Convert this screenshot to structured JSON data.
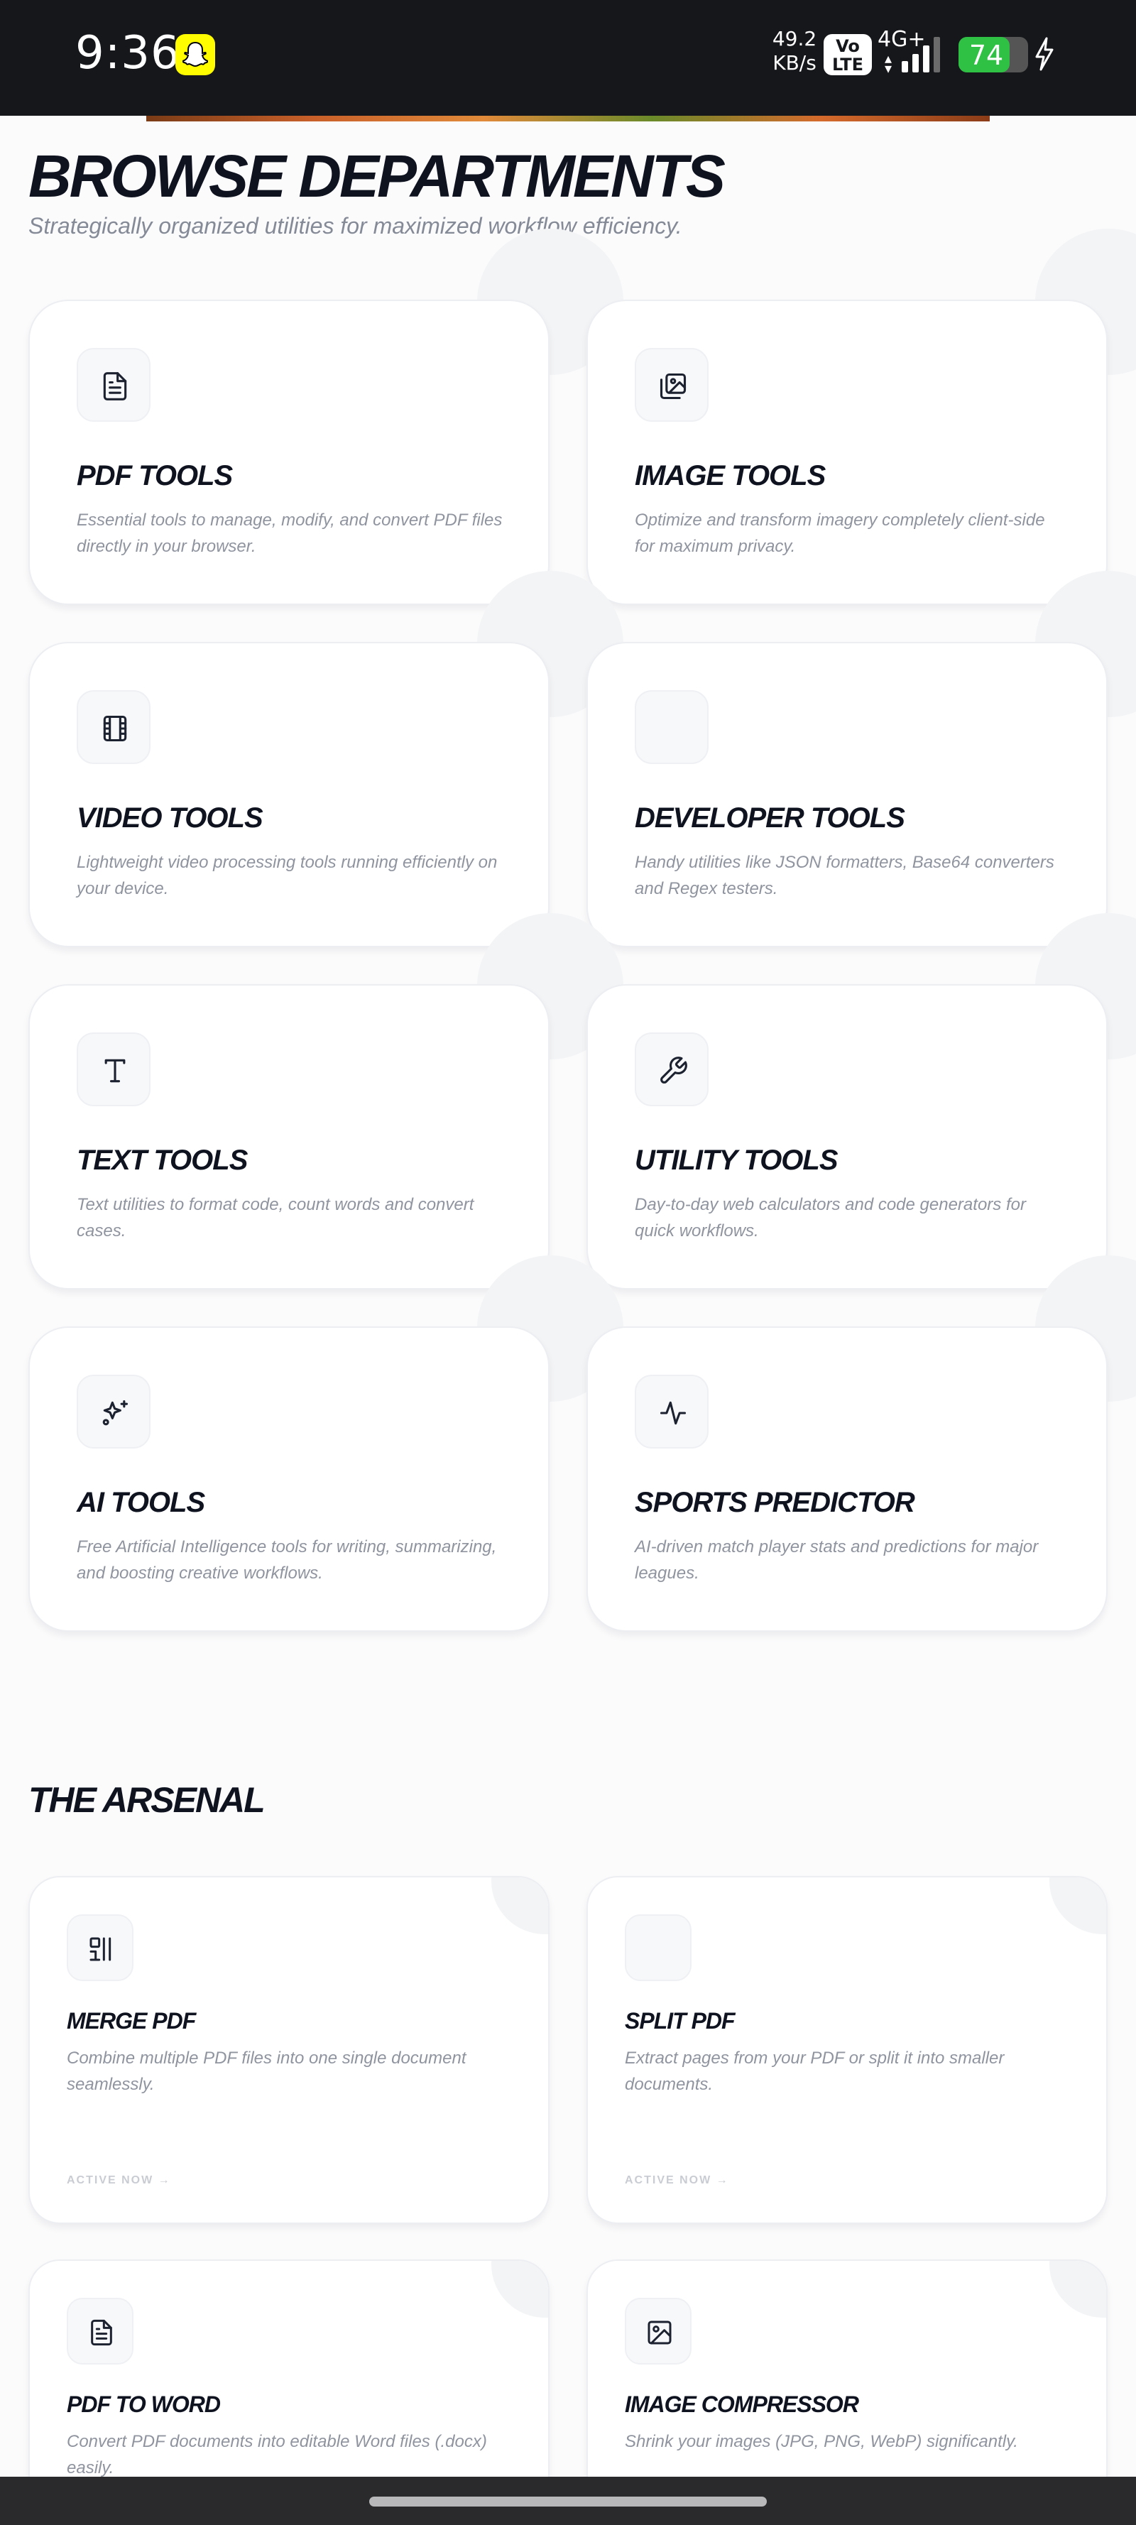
{
  "status": {
    "time": "9:36",
    "speed_value": "49.2",
    "speed_unit": "KB/s",
    "volte_top": "Vo",
    "volte_bottom": "LTE",
    "network": "4G+",
    "battery": "74"
  },
  "departments": {
    "title": "BROWSE DEPARTMENTS",
    "subtitle": "Strategically organized utilities for maximized workflow efficiency.",
    "cards": [
      {
        "title": "PDF TOOLS",
        "desc": "Essential tools to manage, modify, and convert PDF files directly in your browser.",
        "icon": "document-icon"
      },
      {
        "title": "IMAGE TOOLS",
        "desc": "Optimize and transform imagery completely client-side for maximum privacy.",
        "icon": "images-icon"
      },
      {
        "title": "VIDEO TOOLS",
        "desc": "Lightweight video processing tools running efficiently on your device.",
        "icon": "film-icon"
      },
      {
        "title": "DEVELOPER TOOLS",
        "desc": "Handy utilities like JSON formatters, Base64 converters and Regex testers.",
        "icon": ""
      },
      {
        "title": "TEXT TOOLS",
        "desc": "Text utilities to format code, count words and convert cases.",
        "icon": "text-icon"
      },
      {
        "title": "UTILITY TOOLS",
        "desc": "Day-to-day web calculators and code generators for quick workflows.",
        "icon": "wrench-icon"
      },
      {
        "title": "AI TOOLS",
        "desc": "Free Artificial Intelligence tools for writing, summarizing, and boosting creative workflows.",
        "icon": "sparkles-icon"
      },
      {
        "title": "SPORTS PREDICTOR",
        "desc": "AI-driven match player stats and predictions for major leagues.",
        "icon": "activity-icon"
      }
    ]
  },
  "arsenal": {
    "title": "THE ARSENAL",
    "tools": [
      {
        "title": "MERGE PDF",
        "desc": "Combine multiple PDF files into one single document seamlessly.",
        "cta": "ACTIVE NOW",
        "icon": "merge-icon"
      },
      {
        "title": "SPLIT PDF",
        "desc": "Extract pages from your PDF or split it into smaller documents.",
        "cta": "ACTIVE NOW",
        "icon": ""
      },
      {
        "title": "PDF TO WORD",
        "desc": "Convert PDF documents into editable Word files (.docx) easily.",
        "icon": "document-icon"
      },
      {
        "title": "IMAGE COMPRESSOR",
        "desc": "Shrink your images (JPG, PNG, WebP) significantly.",
        "icon": "image-icon"
      }
    ]
  },
  "colors": {
    "background": "#fbfbfc",
    "heading": "#0f1320",
    "muted": "#8f949f",
    "statusbar": "#16171b",
    "battery": "#2fc144"
  }
}
